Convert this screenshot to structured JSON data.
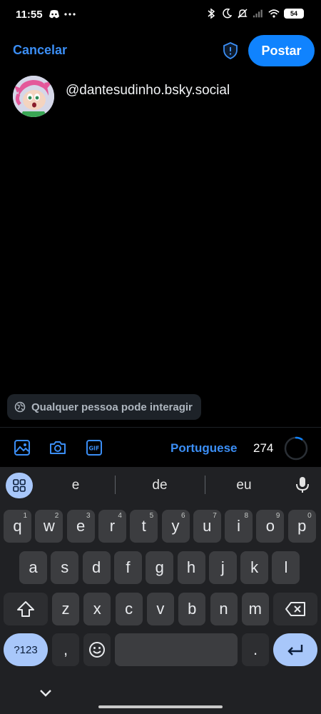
{
  "status_bar": {
    "time": "11:55",
    "battery": "54",
    "icons": [
      "discord-icon",
      "more-dots-icon",
      "bluetooth-icon",
      "moon-icon",
      "muted-bell-icon",
      "signal-icon",
      "wifi-icon",
      "battery-icon"
    ]
  },
  "header": {
    "cancel_label": "Cancelar",
    "post_label": "Postar",
    "accent": "#1083fe"
  },
  "compose": {
    "handle": "@dantesudinho.bsky.social"
  },
  "interaction": {
    "label": "Qualquer pessoa pode interagir"
  },
  "toolbar": {
    "language": "Portuguese",
    "char_count": "274",
    "char_used_fraction": 0.09
  },
  "keyboard": {
    "suggestions": [
      "e",
      "de",
      "eu"
    ],
    "row1": [
      {
        "k": "q",
        "s": "1"
      },
      {
        "k": "w",
        "s": "2"
      },
      {
        "k": "e",
        "s": "3"
      },
      {
        "k": "r",
        "s": "4"
      },
      {
        "k": "t",
        "s": "5"
      },
      {
        "k": "y",
        "s": "6"
      },
      {
        "k": "u",
        "s": "7"
      },
      {
        "k": "i",
        "s": "8"
      },
      {
        "k": "o",
        "s": "9"
      },
      {
        "k": "p",
        "s": "0"
      }
    ],
    "row2": [
      "a",
      "s",
      "d",
      "f",
      "g",
      "h",
      "j",
      "k",
      "l"
    ],
    "row3": [
      "z",
      "x",
      "c",
      "v",
      "b",
      "n",
      "m"
    ],
    "sym_label": "?123",
    "comma": ",",
    "period": "."
  }
}
